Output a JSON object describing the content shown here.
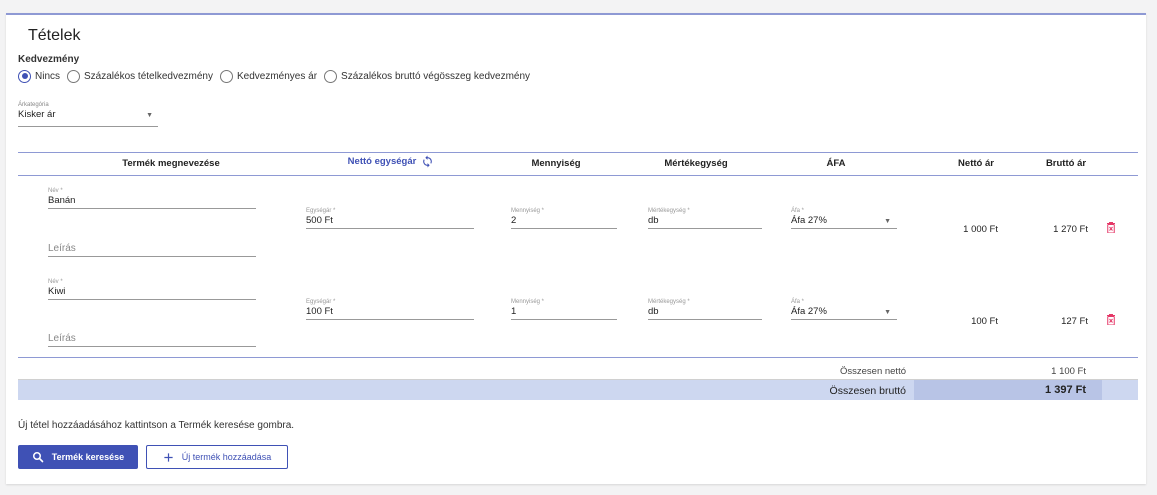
{
  "title": "Tételek",
  "discount": {
    "label": "Kedvezmény",
    "options": [
      "Nincs",
      "Százalékos tételkedvezmény",
      "Kedvezményes ár",
      "Százalékos bruttó végösszeg kedvezmény"
    ],
    "selected": "Nincs"
  },
  "price_category": {
    "label": "Árkategória",
    "value": "Kisker ár"
  },
  "table": {
    "headers": {
      "name": "Termék megnevezése",
      "unit_price": "Nettó egységár",
      "quantity": "Mennyiség",
      "unit": "Mértékegység",
      "vat": "ÁFA",
      "net": "Nettó ár",
      "gross": "Bruttó ár"
    },
    "field_labels": {
      "name": "Név *",
      "description": "Leírás",
      "unit_price": "Egységár *",
      "quantity": "Mennyiség *",
      "unit": "Mértékegység *",
      "vat": "Áfa *"
    },
    "rows": [
      {
        "name": "Banán",
        "unit_price": "500 Ft",
        "quantity": "2",
        "unit": "db",
        "vat": "Áfa 27%",
        "net": "1 000 Ft",
        "gross": "1 270 Ft"
      },
      {
        "name": "Kiwi",
        "unit_price": "100 Ft",
        "quantity": "1",
        "unit": "db",
        "vat": "Áfa 27%",
        "net": "100 Ft",
        "gross": "127 Ft"
      }
    ]
  },
  "totals": {
    "net_label": "Összesen nettó",
    "net_value": "1 100 Ft",
    "gross_label": "Összesen bruttó",
    "gross_value": "1 397 Ft"
  },
  "hint": "Új tétel hozzáadásához kattintson a Termék keresése gombra.",
  "buttons": {
    "search": "Termék keresése",
    "add_new": "Új termék hozzáadása"
  },
  "colors": {
    "primary": "#3f51b5",
    "delete": "#e53968",
    "total_bar": "#cdd7f0"
  },
  "icons": {
    "refresh": "sync-icon",
    "delete": "trash-icon",
    "search": "search-icon",
    "add": "plus-icon"
  }
}
